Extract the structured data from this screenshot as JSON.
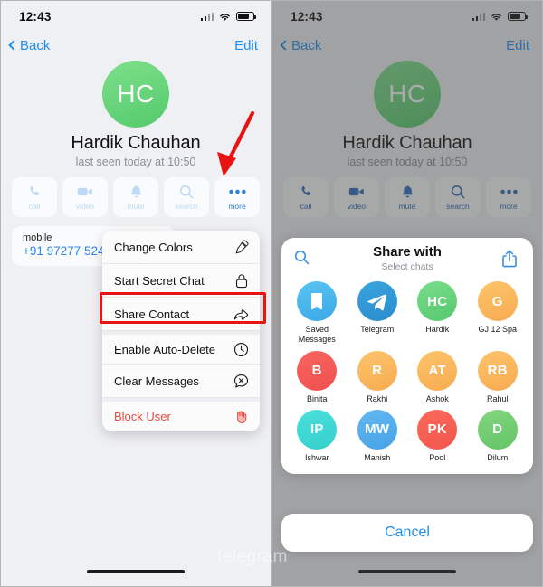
{
  "status_bar": {
    "time": "12:43"
  },
  "nav": {
    "back_label": "Back",
    "edit_label": "Edit"
  },
  "profile": {
    "initials": "HC",
    "name": "Hardik Chauhan",
    "subtitle": "last seen today at 10:50"
  },
  "actions": [
    {
      "label": "call",
      "icon": "phone-icon"
    },
    {
      "label": "video",
      "icon": "video-camera-icon"
    },
    {
      "label": "mute",
      "icon": "bell-icon"
    },
    {
      "label": "search",
      "icon": "search-icon"
    },
    {
      "label": "more",
      "icon": "ellipsis-icon"
    }
  ],
  "info": {
    "label": "mobile",
    "value": "+91 97277 524"
  },
  "context_menu": [
    {
      "label": "Change Colors",
      "icon": "paintbrush-icon",
      "danger": false,
      "highlighted": false
    },
    {
      "label": "Start Secret Chat",
      "icon": "lock-icon",
      "danger": false,
      "highlighted": false
    },
    {
      "label": "Share Contact",
      "icon": "share-arrow-icon",
      "danger": false,
      "highlighted": true
    },
    {
      "label": "Enable Auto-Delete",
      "icon": "timer-icon",
      "danger": false,
      "highlighted": false
    },
    {
      "label": "Clear Messages",
      "icon": "clear-chat-icon",
      "danger": false,
      "highlighted": false
    },
    {
      "label": "Block User",
      "icon": "block-hand-icon",
      "danger": true,
      "highlighted": false
    }
  ],
  "share_sheet": {
    "title": "Share with",
    "subtitle": "Select chats",
    "search_icon": "search-icon",
    "share_icon": "share-upload-icon",
    "cancel_label": "Cancel",
    "chats": [
      {
        "name": "Saved Messages",
        "initials": "",
        "icon": "bookmark-icon",
        "color_from": "#5bc4f1",
        "color_to": "#3aa8e8"
      },
      {
        "name": "Telegram",
        "initials": "",
        "icon": "telegram-plane-icon",
        "color_from": "#39a4de",
        "color_to": "#2b8ccc"
      },
      {
        "name": "Hardik",
        "initials": "HC",
        "icon": "",
        "color_from": "#79dd8a",
        "color_to": "#55c96e"
      },
      {
        "name": "GJ 12 Spa",
        "initials": "G",
        "icon": "",
        "color_from": "#fcc46b",
        "color_to": "#f8ab50"
      },
      {
        "name": "Binita",
        "initials": "B",
        "icon": "",
        "color_from": "#f8655f",
        "color_to": "#f0504f"
      },
      {
        "name": "Rakhi",
        "initials": "R",
        "icon": "",
        "color_from": "#fcc46b",
        "color_to": "#f8ab50"
      },
      {
        "name": "Ashok",
        "initials": "AT",
        "icon": "",
        "color_from": "#fcc46b",
        "color_to": "#f8ab50"
      },
      {
        "name": "Rahul",
        "initials": "RB",
        "icon": "",
        "color_from": "#fcc46b",
        "color_to": "#f8ab50"
      },
      {
        "name": "Ishwar",
        "initials": "IP",
        "icon": "",
        "color_from": "#4ae0dc",
        "color_to": "#35cfcc"
      },
      {
        "name": "Manish",
        "initials": "MW",
        "icon": "",
        "color_from": "#63b8f0",
        "color_to": "#46a2e6"
      },
      {
        "name": "Pool",
        "initials": "PK",
        "icon": "",
        "color_from": "#fb6a5a",
        "color_to": "#f2564d"
      },
      {
        "name": "Dilum",
        "initials": "D",
        "icon": "",
        "color_from": "#84d67f",
        "color_to": "#63c466"
      }
    ]
  },
  "annotations": {
    "arrow_color": "#e81313",
    "highlight_color": "#e81313"
  },
  "watermark": {
    "text": "telegram"
  },
  "colors": {
    "accent_blue": "#1c8ef0",
    "panel_bg": "#eff0f4",
    "card_bg": "#fafbfc",
    "danger_red": "#e8493f"
  }
}
